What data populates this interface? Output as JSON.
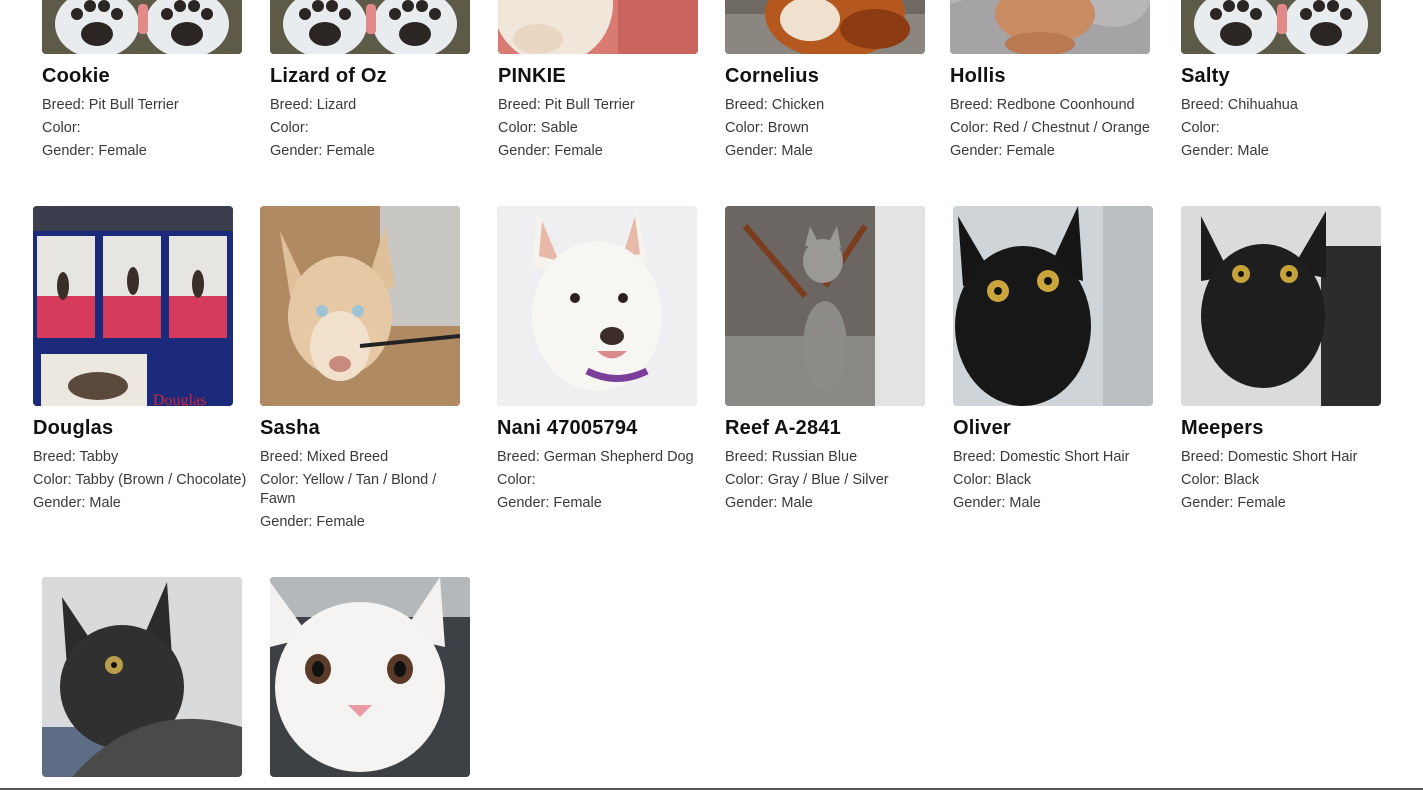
{
  "labels": {
    "breed": "Breed: ",
    "color": "Color: ",
    "gender": "Gender: "
  },
  "pets": [
    {
      "name": "Cookie",
      "breed": "Pit Bull Terrier",
      "color": "",
      "gender": "Female",
      "photo": "paws-photo"
    },
    {
      "name": "Lizard of Oz",
      "breed": "Lizard",
      "color": "",
      "gender": "Female",
      "photo": "paws-photo"
    },
    {
      "name": "PINKIE",
      "breed": "Pit Bull Terrier",
      "color": "Sable",
      "gender": "Female",
      "photo": "dog-pink-photo"
    },
    {
      "name": "Cornelius",
      "breed": "Chicken",
      "color": "Brown",
      "gender": "Male",
      "photo": "chicken-photo"
    },
    {
      "name": "Hollis",
      "breed": "Redbone Coonhound",
      "color": "Red / Chestnut / Orange",
      "gender": "Female",
      "photo": "dog-paws-blanket-photo"
    },
    {
      "name": "Salty",
      "breed": "Chihuahua",
      "color": "",
      "gender": "Male",
      "photo": "paws-photo"
    },
    {
      "name": "Douglas",
      "breed": "Tabby",
      "color": "Tabby (Brown / Chocolate)",
      "gender": "Male",
      "photo": "cat-collage-photo"
    },
    {
      "name": "Sasha",
      "breed": "Mixed Breed",
      "color": "Yellow / Tan / Blond / Fawn",
      "gender": "Female",
      "photo": "husky-photo"
    },
    {
      "name": "Nani 47005794",
      "breed": "German Shepherd Dog",
      "color": "",
      "gender": "Female",
      "photo": "white-shepherd-photo"
    },
    {
      "name": "Reef A-2841",
      "breed": "Russian Blue",
      "color": "Gray / Blue / Silver",
      "gender": "Male",
      "photo": "gray-cat-photo"
    },
    {
      "name": "Oliver",
      "breed": "Domestic Short Hair",
      "color": "Black",
      "gender": "Male",
      "photo": "black-cat-photo"
    },
    {
      "name": "Meepers",
      "breed": "Domestic Short Hair",
      "color": "Black",
      "gender": "Female",
      "photo": "black-cat-photo"
    },
    {
      "name": "",
      "breed": "",
      "color": "",
      "gender": "",
      "photo": "dark-cat-photo"
    },
    {
      "name": "",
      "breed": "",
      "color": "",
      "gender": "",
      "photo": "white-cat-photo"
    }
  ]
}
